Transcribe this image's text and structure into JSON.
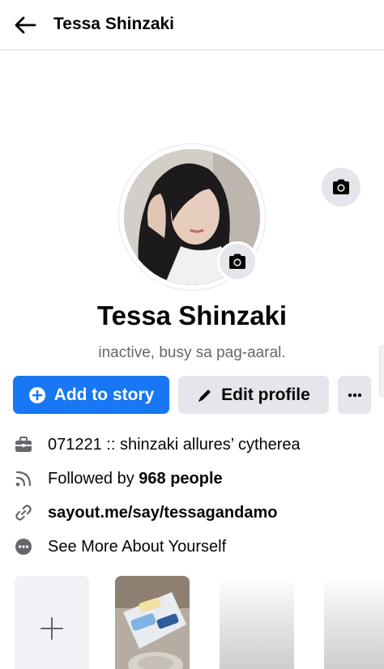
{
  "header": {
    "title": "Tessa Shinzaki",
    "back_icon": "arrow-left-icon"
  },
  "profile": {
    "name": "Tessa Shinzaki",
    "bio": "inactive, busy sa pag-aaral.",
    "avatar_description_icon": "profile-photo",
    "cover_camera_icon": "camera-icon",
    "avatar_camera_icon": "camera-icon"
  },
  "actions": {
    "add_story_label": "Add to story",
    "edit_profile_label": "Edit profile",
    "more_label": "···"
  },
  "details": [
    {
      "icon": "briefcase-icon",
      "text": "071221 :: shinzaki allures’ cytherea"
    },
    {
      "icon": "rss-icon",
      "prefix": "Followed by ",
      "bold": "968 people"
    },
    {
      "icon": "link-icon",
      "text": "sayout.me/say/tessagandamo"
    },
    {
      "icon": "more-circle-icon",
      "text": "See More About Yourself"
    }
  ],
  "stories": {
    "add_icon": "plus-icon"
  },
  "colors": {
    "primary": "#1877f2",
    "secondary_bg": "#e4e6eb",
    "muted_text": "#65676b"
  }
}
